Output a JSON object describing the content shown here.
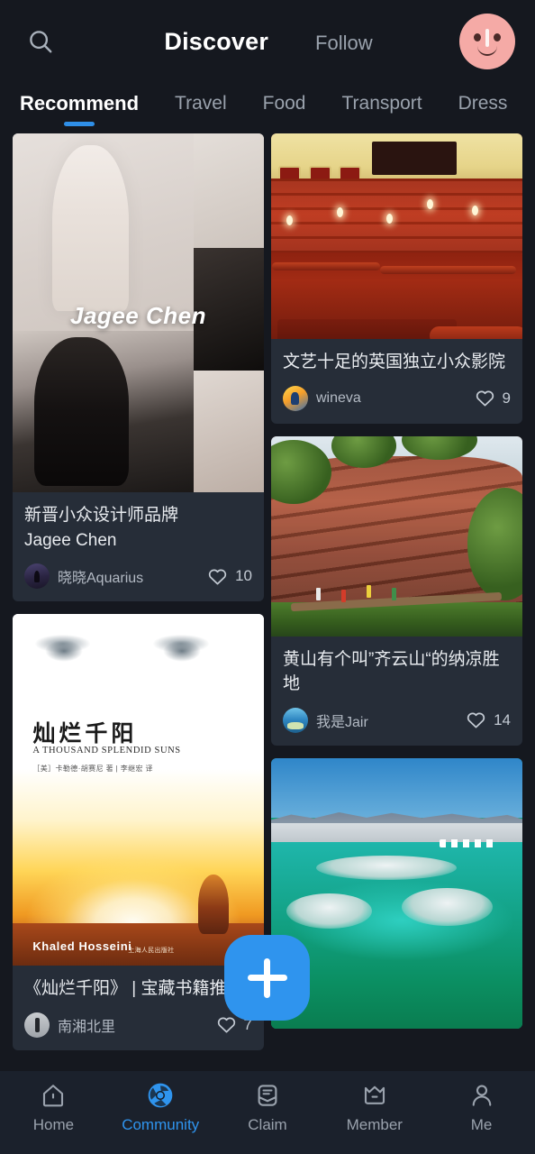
{
  "header": {
    "search_icon": "search-icon",
    "title": "Discover",
    "secondary_tab": "Follow",
    "avatar": "profile-avatar"
  },
  "categories": {
    "active_index": 0,
    "items": [
      {
        "label": "Recommend"
      },
      {
        "label": "Travel"
      },
      {
        "label": "Food"
      },
      {
        "label": "Transport"
      },
      {
        "label": "Dress"
      }
    ]
  },
  "feed": {
    "left_column": [
      {
        "id": "card-jagee-chen",
        "image_kind": "fashion-collage",
        "image_watermark": "Jagee Chen",
        "title_line1": "新晋小众设计师品牌",
        "title_line2": "Jagee Chen",
        "author": "晓晓Aquarius",
        "likes": "10",
        "like_icon": "heart-outline-icon"
      },
      {
        "id": "card-thousand-splendid-suns",
        "image_kind": "book-cover",
        "book_title_cn": "灿烂千阳",
        "book_title_en": "A THOUSAND SPLENDID SUNS",
        "book_credits": "［美］卡勒德·胡赛尼 著 | 李继宏 译",
        "book_author_latin": "Khaled Hosseini",
        "book_publisher": "上海人民出版社",
        "title": "《灿烂千阳》 | 宝藏书籍推荐",
        "author": "南湘北里",
        "likes": "7",
        "like_icon": "heart-outline-icon"
      }
    ],
    "right_column": [
      {
        "id": "card-uk-cinema",
        "image_kind": "cinema-interior",
        "title": "文艺十足的英国独立小众影院",
        "author": "wineva",
        "likes": "9",
        "like_icon": "heart-outline-icon"
      },
      {
        "id": "card-qiyunshan",
        "image_kind": "red-cliff",
        "title": "黄山有个叫”齐云山“的纳凉胜地",
        "author": "我是Jair",
        "likes": "14",
        "like_icon": "heart-outline-icon"
      },
      {
        "id": "card-salt-lake",
        "image_kind": "turquoise-salt-lake",
        "title": "",
        "author": "",
        "likes": "",
        "like_icon": "heart-outline-icon"
      }
    ]
  },
  "fab": {
    "label": "+",
    "icon": "plus-icon"
  },
  "bottom_nav": {
    "active_index": 1,
    "items": [
      {
        "label": "Home",
        "icon": "home-icon"
      },
      {
        "label": "Community",
        "icon": "community-swirl-icon"
      },
      {
        "label": "Claim",
        "icon": "claim-envelope-icon"
      },
      {
        "label": "Member",
        "icon": "crown-icon"
      },
      {
        "label": "Me",
        "icon": "person-icon"
      }
    ]
  },
  "colors": {
    "page_background": "#15181f",
    "card_background": "#262d38",
    "accent_blue": "#2f94ee",
    "tab_underline": "#2f8fe8",
    "nav_background": "#1b212c",
    "muted_text": "#9aa2ad",
    "primary_text": "#ffffff"
  }
}
